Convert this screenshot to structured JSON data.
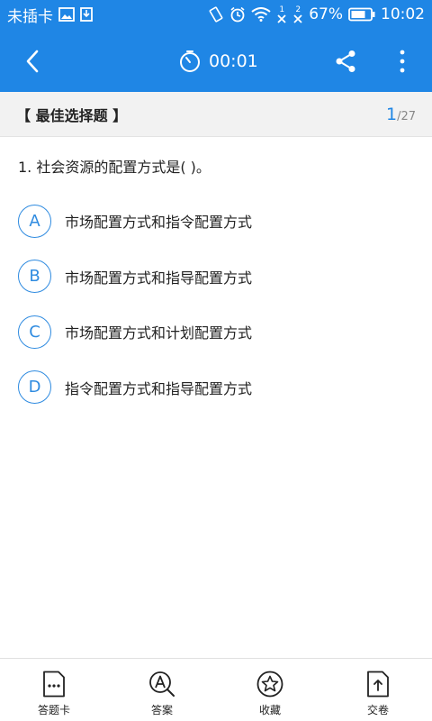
{
  "status_bar": {
    "carrier": "未插卡",
    "battery_percent": "67%",
    "time": "10:02",
    "sim1_label": "1",
    "sim2_label": "2"
  },
  "app_bar": {
    "timer": "00:01",
    "accent_color": "#1f86e5"
  },
  "section": {
    "title": "【 最佳选择题 】",
    "current": "1",
    "separator": "/",
    "total": "27"
  },
  "question": {
    "text": "1. 社会资源的配置方式是(   )。",
    "options": [
      {
        "letter": "A",
        "text": "市场配置方式和指令配置方式"
      },
      {
        "letter": "B",
        "text": "市场配置方式和指导配置方式"
      },
      {
        "letter": "C",
        "text": "市场配置方式和计划配置方式"
      },
      {
        "letter": "D",
        "text": "指令配置方式和指导配置方式"
      }
    ]
  },
  "bottom_nav": [
    {
      "label": "答题卡",
      "icon": "answer-sheet-icon"
    },
    {
      "label": "答案",
      "icon": "answer-search-icon"
    },
    {
      "label": "收藏",
      "icon": "star-icon"
    },
    {
      "label": "交卷",
      "icon": "submit-icon"
    }
  ]
}
